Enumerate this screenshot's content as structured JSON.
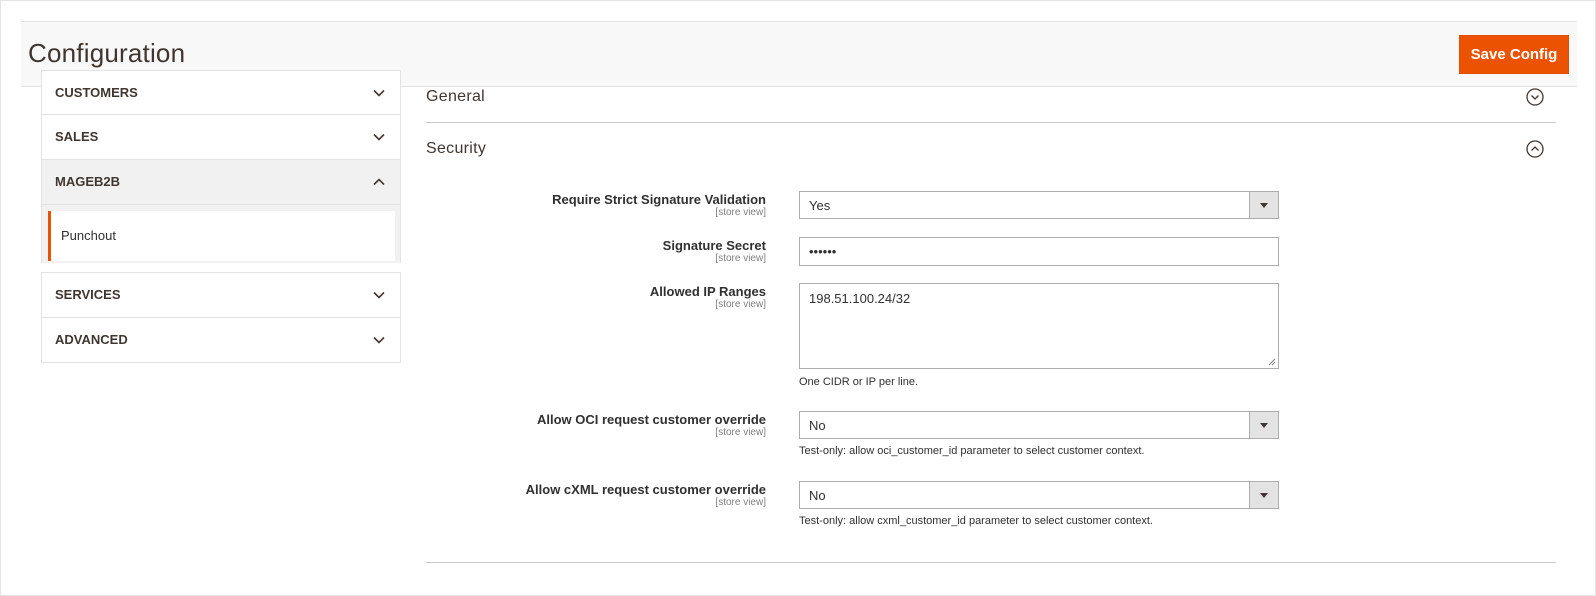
{
  "header": {
    "title": "Configuration",
    "save_label": "Save Config"
  },
  "sidebar": {
    "sections": [
      {
        "label": "CUSTOMERS",
        "expanded": false
      },
      {
        "label": "SALES",
        "expanded": false
      },
      {
        "label": "MAGEB2B",
        "expanded": true,
        "items": [
          {
            "label": "Punchout",
            "active": true
          }
        ]
      },
      {
        "label": "SERVICES",
        "expanded": false
      },
      {
        "label": "ADVANCED",
        "expanded": false
      }
    ]
  },
  "main": {
    "sections": [
      {
        "title": "General",
        "expanded": false
      },
      {
        "title": "Security",
        "expanded": true
      }
    ],
    "fields": [
      {
        "label": "Require Strict Signature Validation",
        "scope": "[store view]",
        "type": "select",
        "value": "Yes"
      },
      {
        "label": "Signature Secret",
        "scope": "[store view]",
        "type": "password",
        "value": "••••••"
      },
      {
        "label": "Allowed IP Ranges",
        "scope": "[store view]",
        "type": "textarea",
        "value": "198.51.100.24/32",
        "note": "One CIDR or IP per line."
      },
      {
        "label": "Allow OCI request customer override",
        "scope": "[store view]",
        "type": "select",
        "value": "No",
        "note": "Test-only: allow oci_customer_id parameter to select customer context."
      },
      {
        "label": "Allow cXML request customer override",
        "scope": "[store view]",
        "type": "select",
        "value": "No",
        "note": "Test-only: allow cxml_customer_id parameter to select customer context."
      }
    ]
  },
  "colors": {
    "accent": "#eb5202",
    "text": "#303030",
    "border": "#adadad"
  }
}
